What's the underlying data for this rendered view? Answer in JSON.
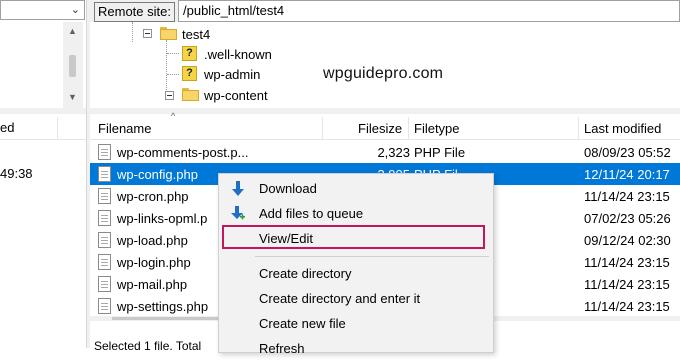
{
  "left_pane": {
    "header_fragment": "ed",
    "row_time_fragment": "49:38"
  },
  "remote_site": {
    "label": "Remote site:",
    "path": "/public_html/test4"
  },
  "tree": {
    "items": [
      {
        "label": "test4",
        "icon": "folder-open-icon"
      },
      {
        "label": ".well-known",
        "icon": "unknown-folder-icon"
      },
      {
        "label": "wp-admin",
        "icon": "unknown-folder-icon"
      },
      {
        "label": "wp-content",
        "icon": "folder-icon"
      }
    ]
  },
  "watermark": "wpguidepro.com",
  "file_list": {
    "columns": [
      "Filename",
      "Filesize",
      "Filetype",
      "Last modified"
    ],
    "rows": [
      {
        "name": "wp-comments-post.p...",
        "size": "2,323",
        "type": "PHP File",
        "modified": "08/09/23 05:52"
      },
      {
        "name": "wp-config.php",
        "size": "3,905",
        "type": "PHP Fil",
        "modified": "12/11/24 20:17",
        "selected": true
      },
      {
        "name": "wp-cron.php",
        "size": "",
        "type": "",
        "modified": "11/14/24 23:15"
      },
      {
        "name": "wp-links-opml.p",
        "size": "",
        "type": "",
        "modified": "07/02/23 05:26"
      },
      {
        "name": "wp-load.php",
        "size": "",
        "type": "",
        "modified": "09/12/24 02:30"
      },
      {
        "name": "wp-login.php",
        "size": "",
        "type": "",
        "modified": "11/14/24 23:15"
      },
      {
        "name": "wp-mail.php",
        "size": "",
        "type": "",
        "modified": "11/14/24 23:15"
      },
      {
        "name": "wp-settings.php",
        "size": "",
        "type": "",
        "modified": "11/14/24 23:15"
      }
    ]
  },
  "status_bar": "Selected 1 file. Total",
  "context_menu": {
    "items": [
      {
        "label": "Download",
        "icon": "download-arrow-icon"
      },
      {
        "label": "Add files to queue",
        "icon": "add-to-queue-icon"
      },
      {
        "label": "View/Edit",
        "icon": ""
      },
      {
        "label": "Create directory",
        "icon": ""
      },
      {
        "label": "Create directory and enter it",
        "icon": ""
      },
      {
        "label": "Create new file",
        "icon": ""
      },
      {
        "label": "Refresh",
        "icon": ""
      }
    ],
    "highlight_color": "#c2185b"
  },
  "colors": {
    "selection": "#0078d7",
    "folder": "#f7d56b",
    "menu_bg": "#f2f2f2"
  }
}
